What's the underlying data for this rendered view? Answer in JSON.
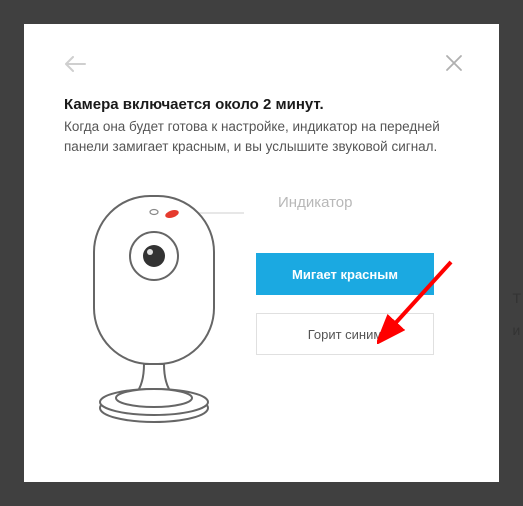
{
  "modal": {
    "title": "Камера включается около 2 минут.",
    "description": "Когда она будет готова к настройке, индикатор на передней панели замигает красным, и вы услышите звуковой сигнал.",
    "indicator_label": "Индикатор",
    "primary_btn": "Мигает красным",
    "secondary_btn": "Горит синим"
  },
  "colors": {
    "primary": "#1ba9e1",
    "indicator_led": "#e53a2e"
  }
}
